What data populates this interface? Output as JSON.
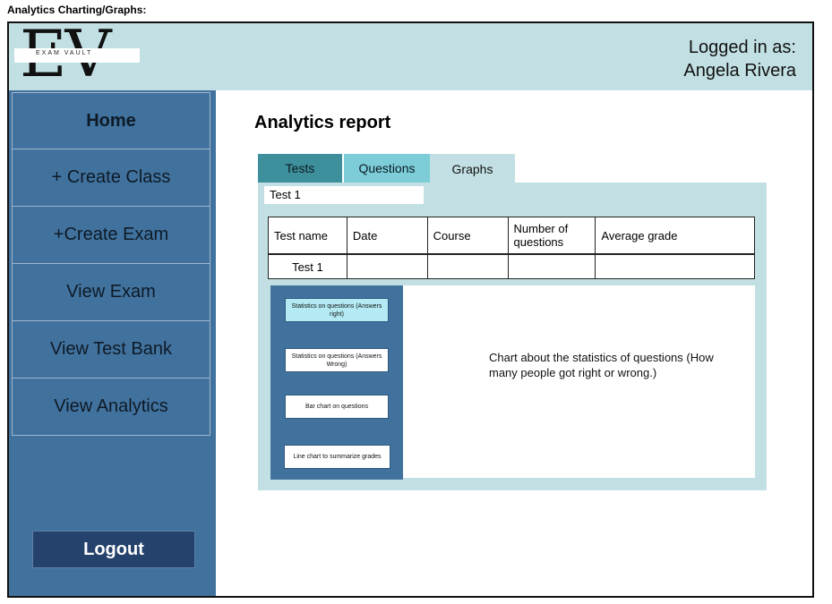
{
  "caption": "Analytics Charting/Graphs:",
  "logo": {
    "letters": "EV",
    "brand": "EXAM VAULT"
  },
  "header": {
    "login_label": "Logged in as:",
    "user_name": "Angela Rivera"
  },
  "sidebar": {
    "items": [
      {
        "label": "Home"
      },
      {
        "label": "+ Create Class"
      },
      {
        "label": "+Create Exam"
      },
      {
        "label": "View Exam"
      },
      {
        "label": "View Test Bank"
      },
      {
        "label": "View Analytics"
      }
    ],
    "logout_label": "Logout"
  },
  "main": {
    "title": "Analytics report",
    "tabs": [
      {
        "label": "Tests"
      },
      {
        "label": "Questions"
      },
      {
        "label": "Graphs"
      }
    ],
    "active_tab": "Graphs",
    "test_field_value": "Test 1",
    "table": {
      "headers": [
        "Test name",
        "Date",
        "Course",
        "Number of questions",
        "Average grade"
      ],
      "rows": [
        [
          "Test 1",
          "",
          "",
          "",
          ""
        ]
      ]
    },
    "chart_buttons": [
      {
        "label": "Statistics on questions (Answers right)"
      },
      {
        "label": "Statistics on questions (Answers Wrong)"
      },
      {
        "label": "Bar chart on questions"
      },
      {
        "label": "Line chart to summarize grades"
      }
    ],
    "chart_description": "Chart about the statistics of questions (How many people got right or wrong.)"
  },
  "colors": {
    "header_bg": "#c2e0e3",
    "sidebar_bg": "#41729e",
    "logout_bg": "#24426b",
    "tab_tests": "#3d8f9b",
    "tab_questions": "#7ccdd8",
    "active_button": "#b4eaf3"
  }
}
